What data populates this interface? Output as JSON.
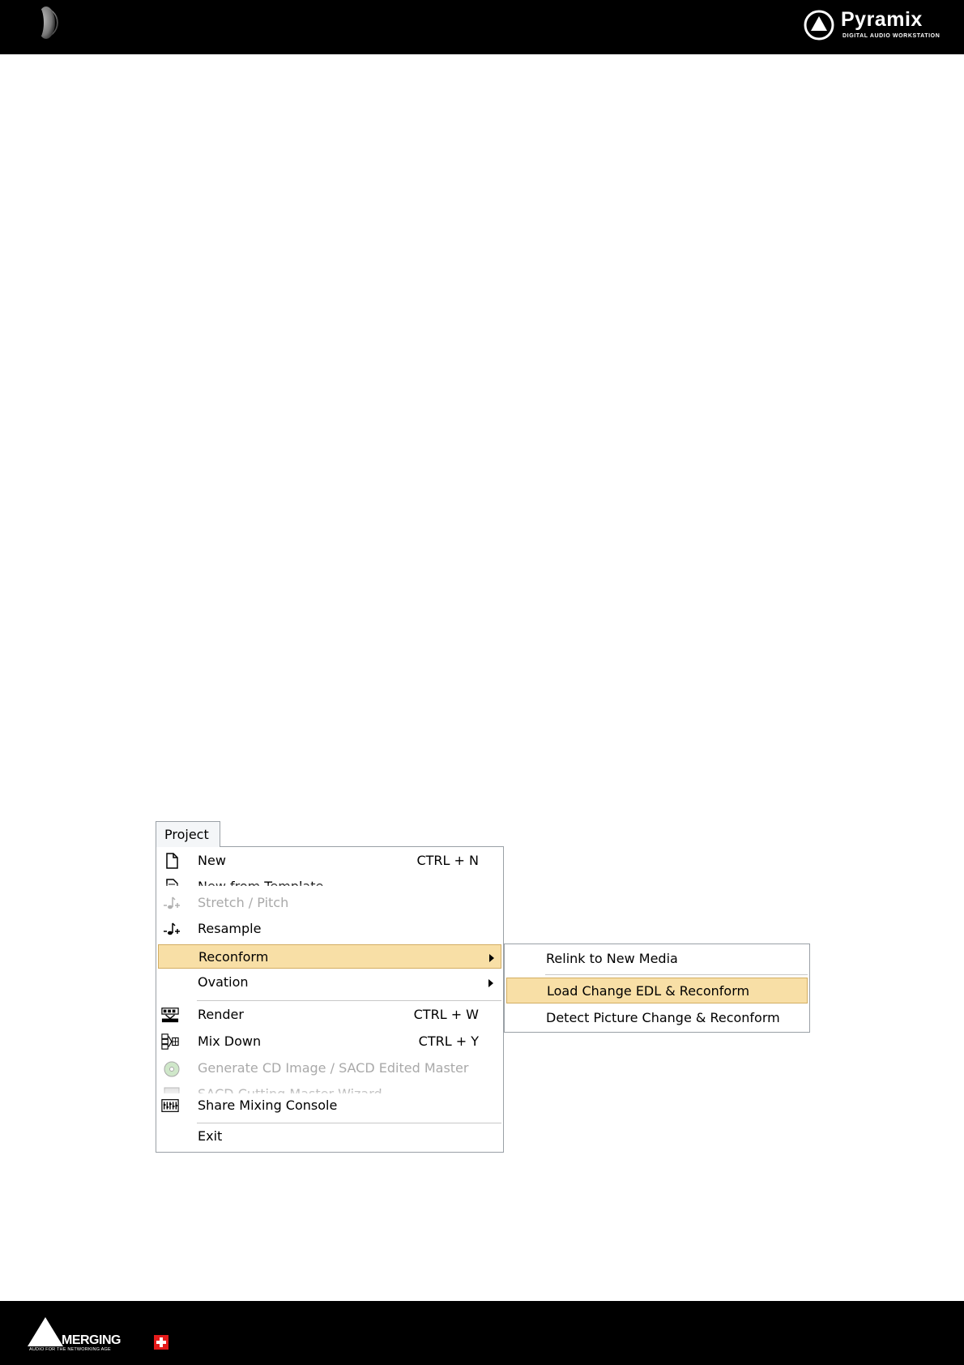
{
  "header": {
    "brand": "Pyramix",
    "tagline": "DIGITAL AUDIO WORKSTATION"
  },
  "footer": {
    "brand": "MERGING",
    "tagline": "AUDIO FOR THE NETWORKING AGE",
    "accent_color": "#e41b1b"
  },
  "menu": {
    "title": "Project",
    "items": [
      {
        "label": "New",
        "shortcut": "CTRL + N",
        "icon": "new-document-icon"
      },
      {
        "label": "New from Template",
        "icon": "template-icon"
      },
      {
        "label": "Stretch / Pitch",
        "icon": "stretch-pitch-icon",
        "disabled": true
      },
      {
        "label": "Resample",
        "icon": "resample-icon"
      },
      {
        "label": "Reconform",
        "submenu": true,
        "highlighted": true
      },
      {
        "label": "Ovation",
        "submenu": true
      },
      {
        "label": "Render",
        "shortcut": "CTRL + W",
        "icon": "render-icon"
      },
      {
        "label": "Mix Down",
        "shortcut": "CTRL + Y",
        "icon": "mix-down-icon"
      },
      {
        "label": "Generate CD Image / SACD Edited Master",
        "icon": "cd-image-icon",
        "disabled": true
      },
      {
        "label": "SACD Cutting Master Wizard",
        "icon": "sacd-wizard-icon",
        "disabled": true
      },
      {
        "label": "Share Mixing Console",
        "icon": "share-console-icon"
      },
      {
        "label": "Exit"
      }
    ],
    "highlight_color": "#f8dfa6"
  },
  "submenu": {
    "items": [
      {
        "label": "Relink to New Media"
      },
      {
        "label": "Load Change EDL & Reconform",
        "highlighted": true
      },
      {
        "label": "Detect Picture Change & Reconform"
      }
    ]
  }
}
